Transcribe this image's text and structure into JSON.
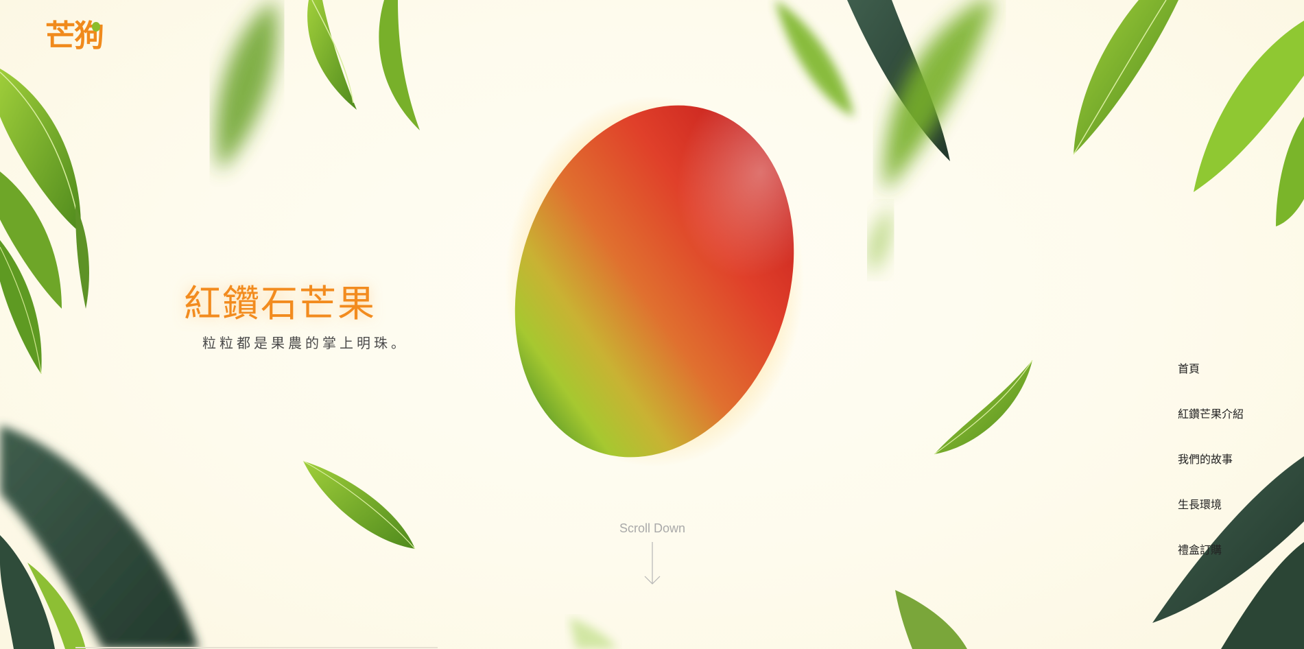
{
  "brand": {
    "logo_text": "芒狗"
  },
  "hero": {
    "title": "紅鑽石芒果",
    "subtitle": "粒粒都是果農的掌上明珠。"
  },
  "scroll": {
    "label": "Scroll Down"
  },
  "nav": {
    "items": [
      {
        "label": "首頁"
      },
      {
        "label": "紅鑽芒果介紹"
      },
      {
        "label": "我們的故事"
      },
      {
        "label": "生長環境"
      },
      {
        "label": "禮盒訂購"
      }
    ]
  },
  "colors": {
    "accent": "#f28b1e",
    "leaf_light": "#7fb52a",
    "leaf_dark": "#2e4a3c",
    "background": "#fefbed"
  }
}
